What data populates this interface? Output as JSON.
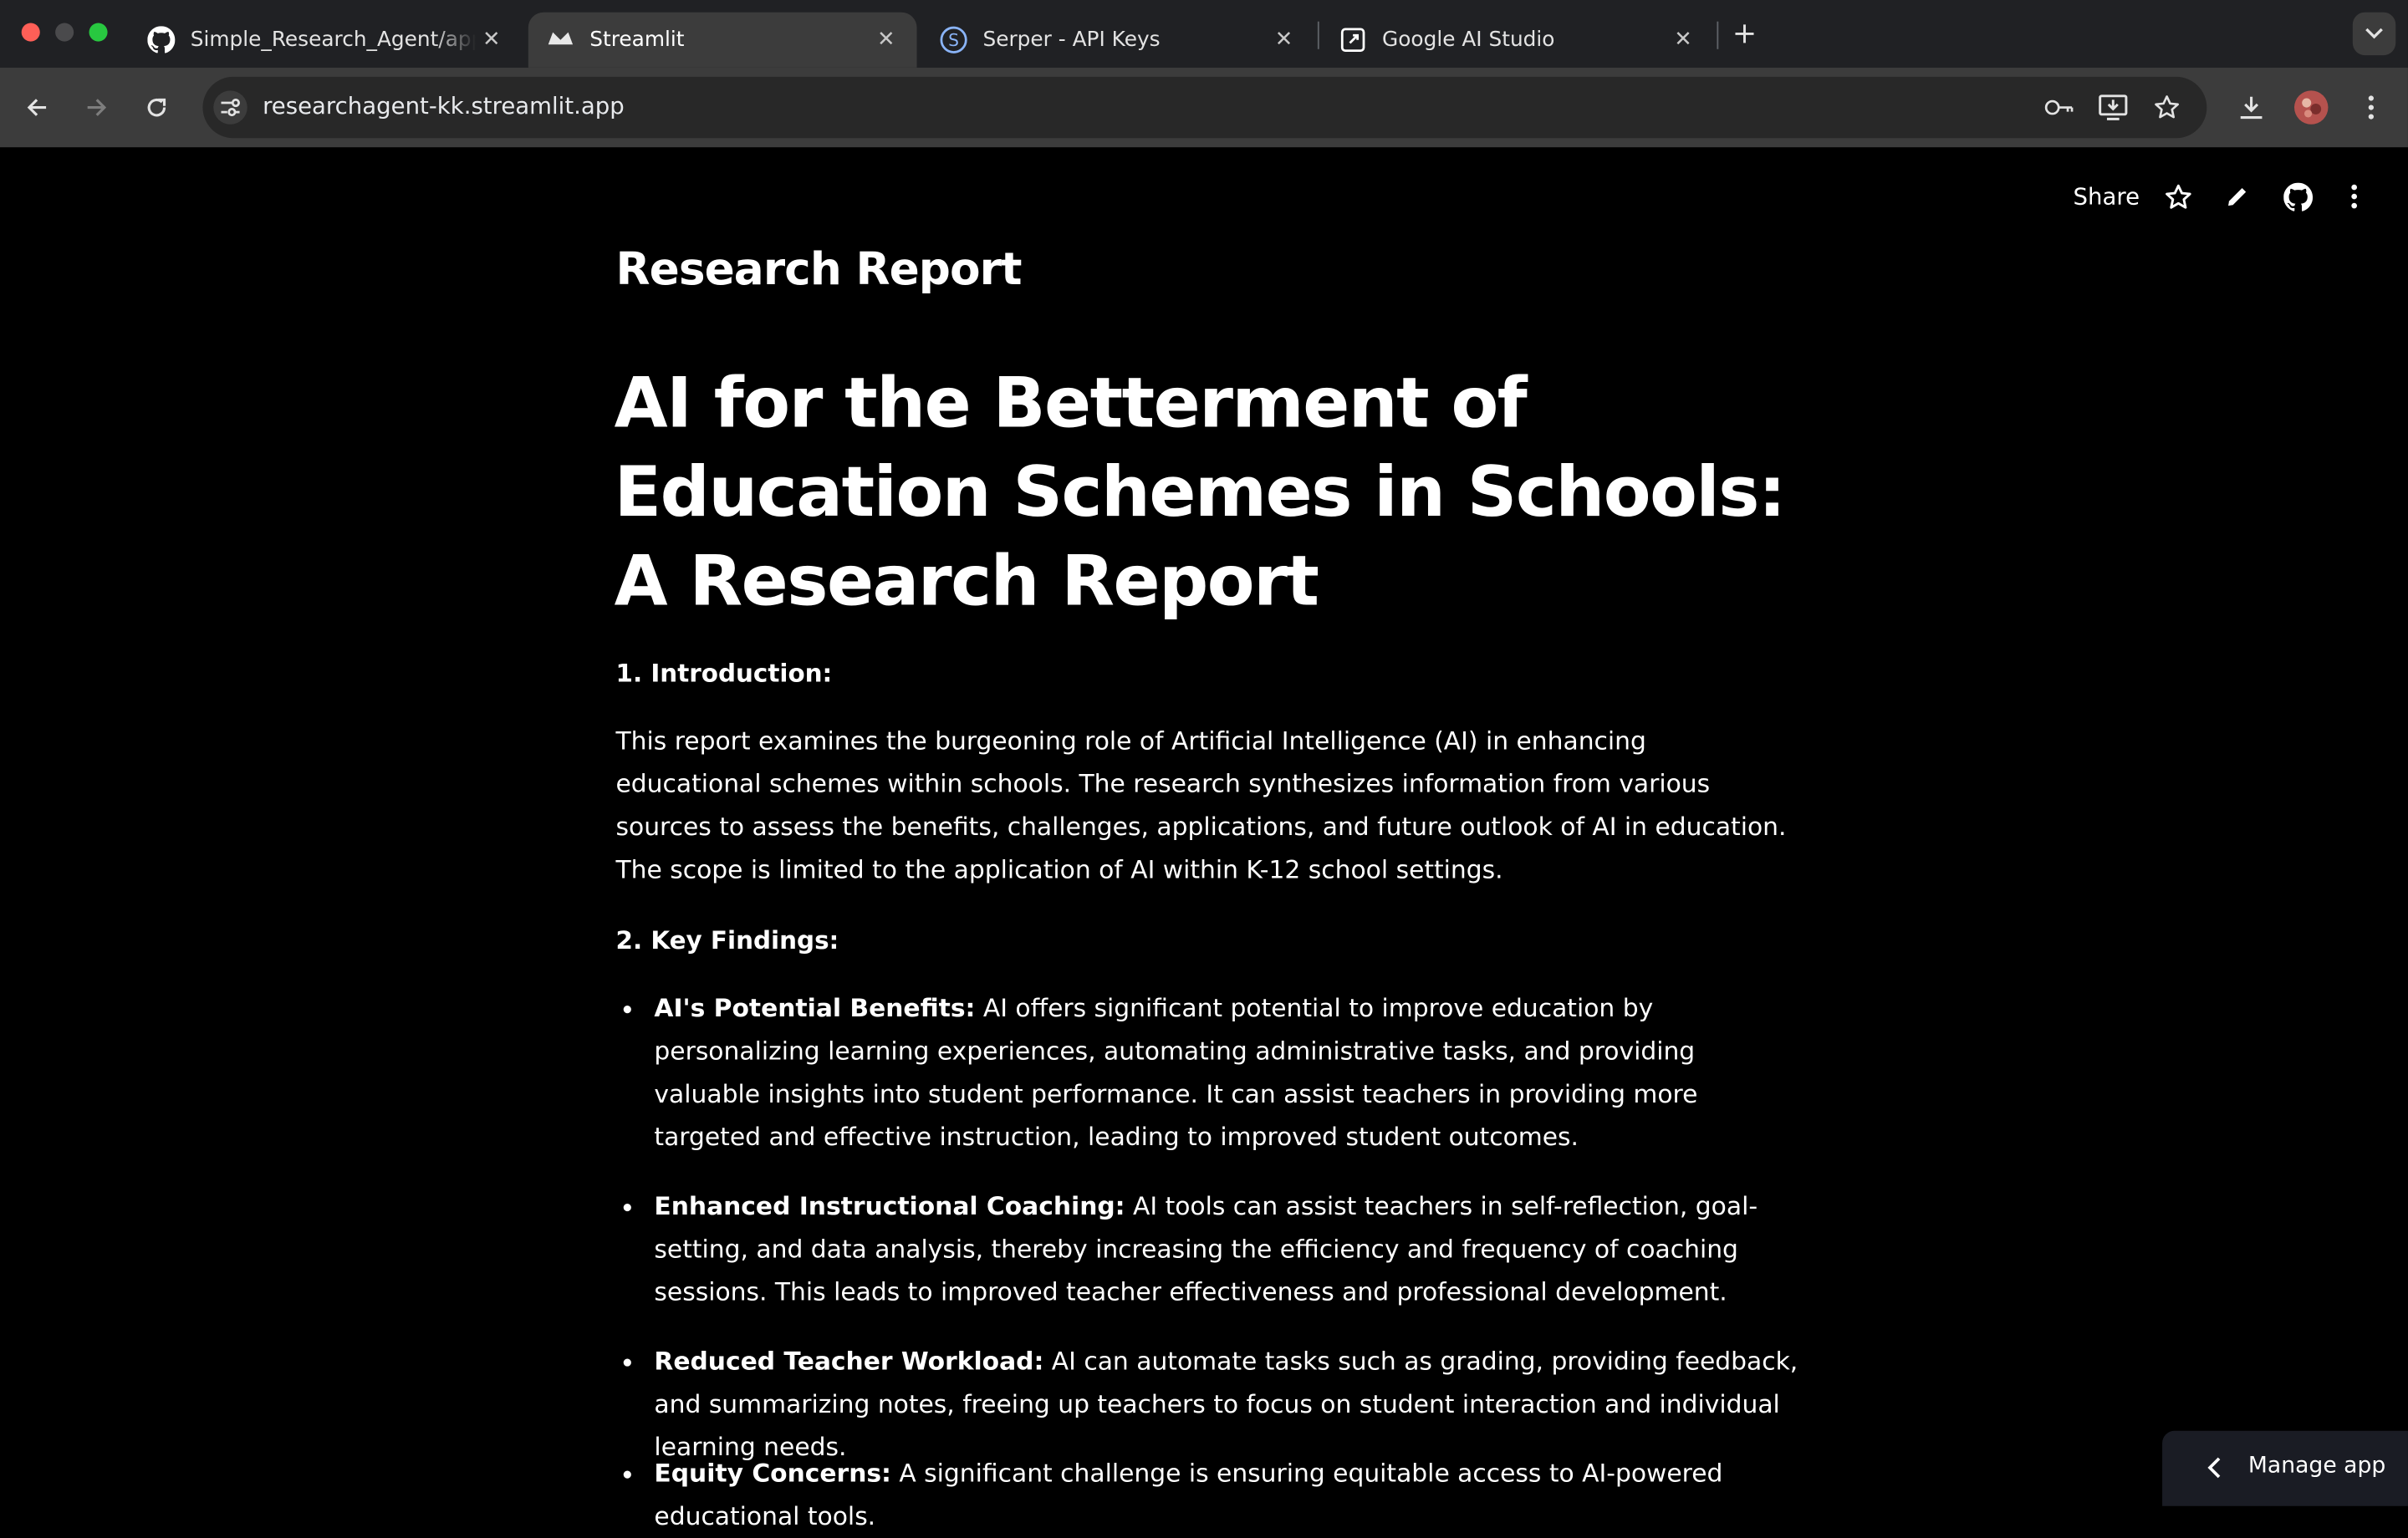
{
  "browser": {
    "tabs": [
      {
        "title": "Simple_Research_Agent/app.py",
        "favicon": "github-icon"
      },
      {
        "title": "Streamlit",
        "favicon": "streamlit-icon"
      },
      {
        "title": "Serper - API Keys",
        "favicon": "serper-icon"
      },
      {
        "title": "Google AI Studio",
        "favicon": "ai-studio-icon"
      }
    ],
    "url": "researchagent-kk.streamlit.app",
    "colors": {
      "tabstrip": "#202124",
      "toolbar": "#3c3c3c",
      "omnibox": "#282828"
    }
  },
  "app": {
    "header": {
      "share_label": "Share"
    },
    "report_label": "Research Report",
    "title": "AI for the Betterment of Education Schemes in Schools: A Research Report",
    "sections": {
      "intro_heading": "1. Introduction:",
      "intro_text": "This report examines the burgeoning role of Artificial Intelligence (AI) in enhancing educational schemes within schools. The research synthesizes information from various sources to assess the benefits, challenges, applications, and future outlook of AI in education. The scope is limited to the application of AI within K-12 school settings.",
      "findings_heading": "2. Key Findings:",
      "findings": [
        {
          "label": "AI's Potential Benefits:",
          "text": " AI offers significant potential to improve education by personalizing learning experiences, automating administrative tasks, and providing valuable insights into student performance. It can assist teachers in providing more targeted and effective instruction, leading to improved student outcomes."
        },
        {
          "label": "Enhanced Instructional Coaching:",
          "text": " AI tools can assist teachers in self-reflection, goal-setting, and data analysis, thereby increasing the efficiency and frequency of coaching sessions. This leads to improved teacher effectiveness and professional development."
        },
        {
          "label": "Reduced Teacher Workload:",
          "text": " AI can automate tasks such as grading, providing feedback, and summarizing notes, freeing up teachers to focus on student interaction and individual learning needs."
        },
        {
          "label": "Equity Concerns:",
          "text": " A significant challenge is ensuring equitable access to AI-powered educational tools."
        }
      ]
    },
    "manage_app_label": "Manage app"
  }
}
